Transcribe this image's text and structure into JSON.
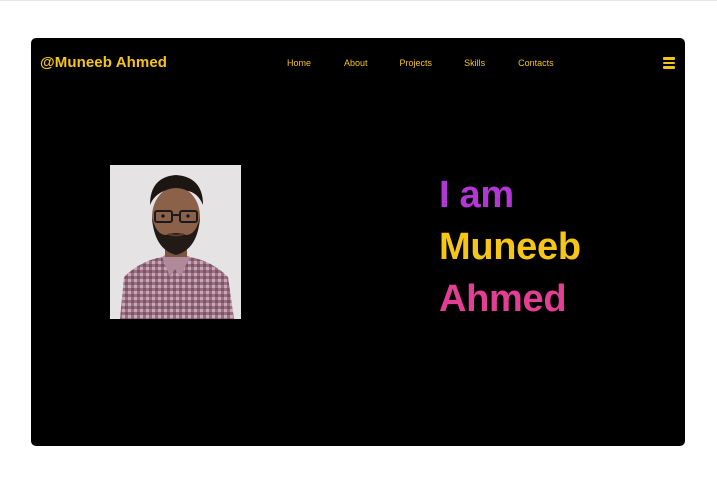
{
  "header": {
    "brand": "@Muneeb Ahmed",
    "nav": {
      "home": "Home",
      "about": "About",
      "projects": "Projects",
      "skills": "Skills",
      "contacts": "Contacts"
    },
    "menu_icon": "hamburger-menu-icon"
  },
  "hero": {
    "line1": "I am",
    "line2": "Muneeb",
    "line3": "Ahmed"
  },
  "colors": {
    "background": "#000000",
    "accent_yellow": "#f5c518",
    "purple": "#b337d4",
    "pink": "#e23e93"
  }
}
